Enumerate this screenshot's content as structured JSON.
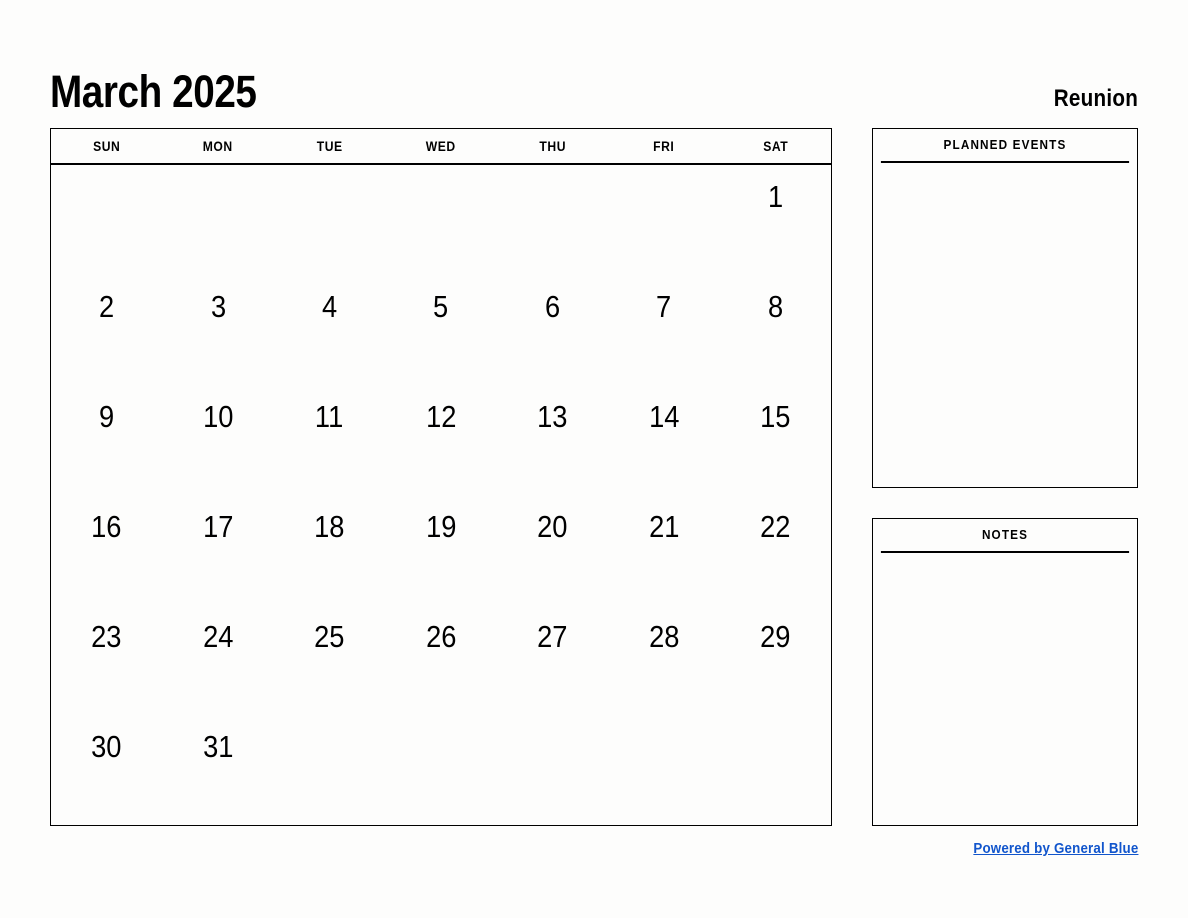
{
  "header": {
    "month_title": "March 2025",
    "region": "Reunion"
  },
  "calendar": {
    "weekdays": [
      "SUN",
      "MON",
      "TUE",
      "WED",
      "THU",
      "FRI",
      "SAT"
    ],
    "weeks": [
      [
        "",
        "",
        "",
        "",
        "",
        "",
        "1"
      ],
      [
        "2",
        "3",
        "4",
        "5",
        "6",
        "7",
        "8"
      ],
      [
        "9",
        "10",
        "11",
        "12",
        "13",
        "14",
        "15"
      ],
      [
        "16",
        "17",
        "18",
        "19",
        "20",
        "21",
        "22"
      ],
      [
        "23",
        "24",
        "25",
        "26",
        "27",
        "28",
        "29"
      ],
      [
        "30",
        "31",
        "",
        "",
        "",
        "",
        ""
      ]
    ]
  },
  "panels": {
    "planned_events": {
      "title": "PLANNED EVENTS",
      "content": ""
    },
    "notes": {
      "title": "NOTES",
      "content": ""
    }
  },
  "footer": {
    "link_label": "Powered by General Blue"
  },
  "colors": {
    "link": "#1155cc",
    "border": "#000000",
    "background": "#fdfdfc",
    "text": "#000000"
  }
}
